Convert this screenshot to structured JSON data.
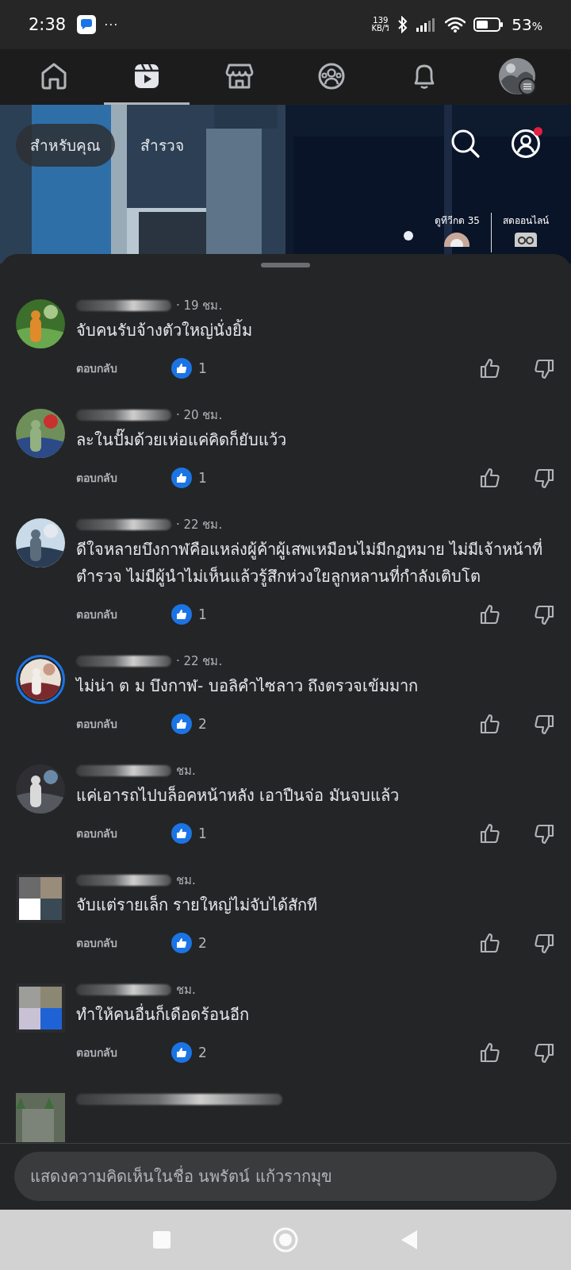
{
  "status_bar": {
    "time": "2:38",
    "more": "···",
    "net_speed": "139",
    "net_unit": "KB/วิ",
    "battery": "53",
    "battery_unit": "%"
  },
  "nav": {
    "tabs": [
      {
        "kind": "home",
        "selected": false
      },
      {
        "kind": "video",
        "selected": true
      },
      {
        "kind": "shop",
        "selected": false
      },
      {
        "kind": "groups",
        "selected": false
      },
      {
        "kind": "bell",
        "selected": false
      },
      {
        "kind": "profile",
        "selected": false
      }
    ]
  },
  "video": {
    "kind": "picture",
    "feed_tabs": [
      {
        "label": "สำหรับคุณ",
        "selected": true
      },
      {
        "label": "สำรวจ",
        "selected": false
      }
    ],
    "profile_notification": true,
    "shortcuts": [
      {
        "label": "ดูทีวีกด 35"
      },
      {
        "label": "สดออนไลน์"
      }
    ]
  },
  "comments": [
    {
      "time": "· 19 ชม.",
      "text": "จับคนรับจ้างตัวใหญ่นั่งยิ้ม",
      "reply": "ตอบกลับ",
      "likes": "1",
      "story_ring": false
    },
    {
      "time": "· 20 ชม.",
      "text": "ละในปั๊มด้วยเห่อแค่คิดก็ยับแว้ว",
      "reply": "ตอบกลับ",
      "likes": "1",
      "story_ring": false
    },
    {
      "time": "· 22 ชม.",
      "text": "ดีใจหลายบึงกาฬคือแหล่งผู้ค้าผู้เสพเหมือนไม่มีกฏหมาย ไม่มีเจ้าหน้าที่ตำรวจ ไม่มีผู้นำไม่เห็นแล้วรู้สึกห่วงใยลูกหลานที่กำลังเติบโต",
      "reply": "ตอบกลับ",
      "likes": "1",
      "story_ring": false
    },
    {
      "time": "· 22 ชม.",
      "text": "ไม่น่า ต ม บึงกาฬ- บอลิคำไซลาว ถึงตรวจเข้มมาก",
      "reply": "ตอบกลับ",
      "likes": "2",
      "story_ring": true
    },
    {
      "time": "ชม.",
      "text": "แค่เอารถไปบล็อคหน้าหลัง เอาปืนจ่อ มันจบแล้ว",
      "reply": "ตอบกลับ",
      "likes": "1",
      "story_ring": false
    },
    {
      "time": "ชม.",
      "text": "จับแต่รายเล็ก รายใหญ่ไม่จับได้สักที",
      "reply": "ตอบกลับ",
      "likes": "2",
      "story_ring": false
    },
    {
      "time": "ชม.",
      "text": "ทำให้คนอื่นก็เดือดร้อนอีก",
      "reply": "ตอบกลับ",
      "likes": "2",
      "story_ring": false
    }
  ],
  "composer": {
    "placeholder": "แสดงความคิดเห็นในชื่อ นพรัตน์ แก้วรากมุข"
  }
}
